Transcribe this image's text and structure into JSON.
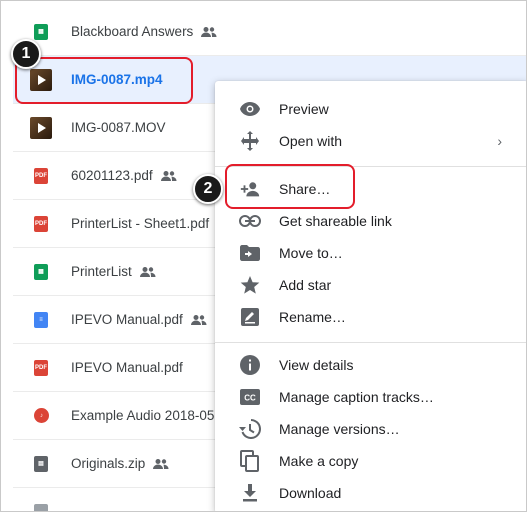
{
  "files": [
    {
      "name": "Blackboard Answers",
      "type": "sheet",
      "shared": true
    },
    {
      "name": "IMG-0087.mp4",
      "type": "video",
      "shared": false,
      "selected": true
    },
    {
      "name": "IMG-0087.MOV",
      "type": "video",
      "shared": false
    },
    {
      "name": "60201123.pdf",
      "type": "pdf",
      "shared": true
    },
    {
      "name": "PrinterList - Sheet1.pdf",
      "type": "pdf",
      "shared": true
    },
    {
      "name": "PrinterList",
      "type": "sheet",
      "shared": true
    },
    {
      "name": "IPEVO Manual.pdf",
      "type": "doc",
      "shared": true
    },
    {
      "name": "IPEVO Manual.pdf",
      "type": "pdf",
      "shared": false
    },
    {
      "name": "Example Audio 2018-05-",
      "type": "audio",
      "shared": false
    },
    {
      "name": "Originals.zip",
      "type": "zip",
      "shared": true
    }
  ],
  "pdf_label": "PDF",
  "callouts": {
    "one": "1",
    "two": "2"
  },
  "menu": {
    "preview": "Preview",
    "open_with": "Open with",
    "open_with_chevron": "›",
    "share": "Share…",
    "get_link": "Get shareable link",
    "move_to": "Move to…",
    "add_star": "Add star",
    "rename": "Rename…",
    "view_details": "View details",
    "captions": "Manage caption tracks…",
    "versions": "Manage versions…",
    "make_copy": "Make a copy",
    "download": "Download"
  },
  "colors": {
    "accent": "#1a73e8",
    "callout": "#e31d2b",
    "selected_bg": "#e8f0fe"
  }
}
